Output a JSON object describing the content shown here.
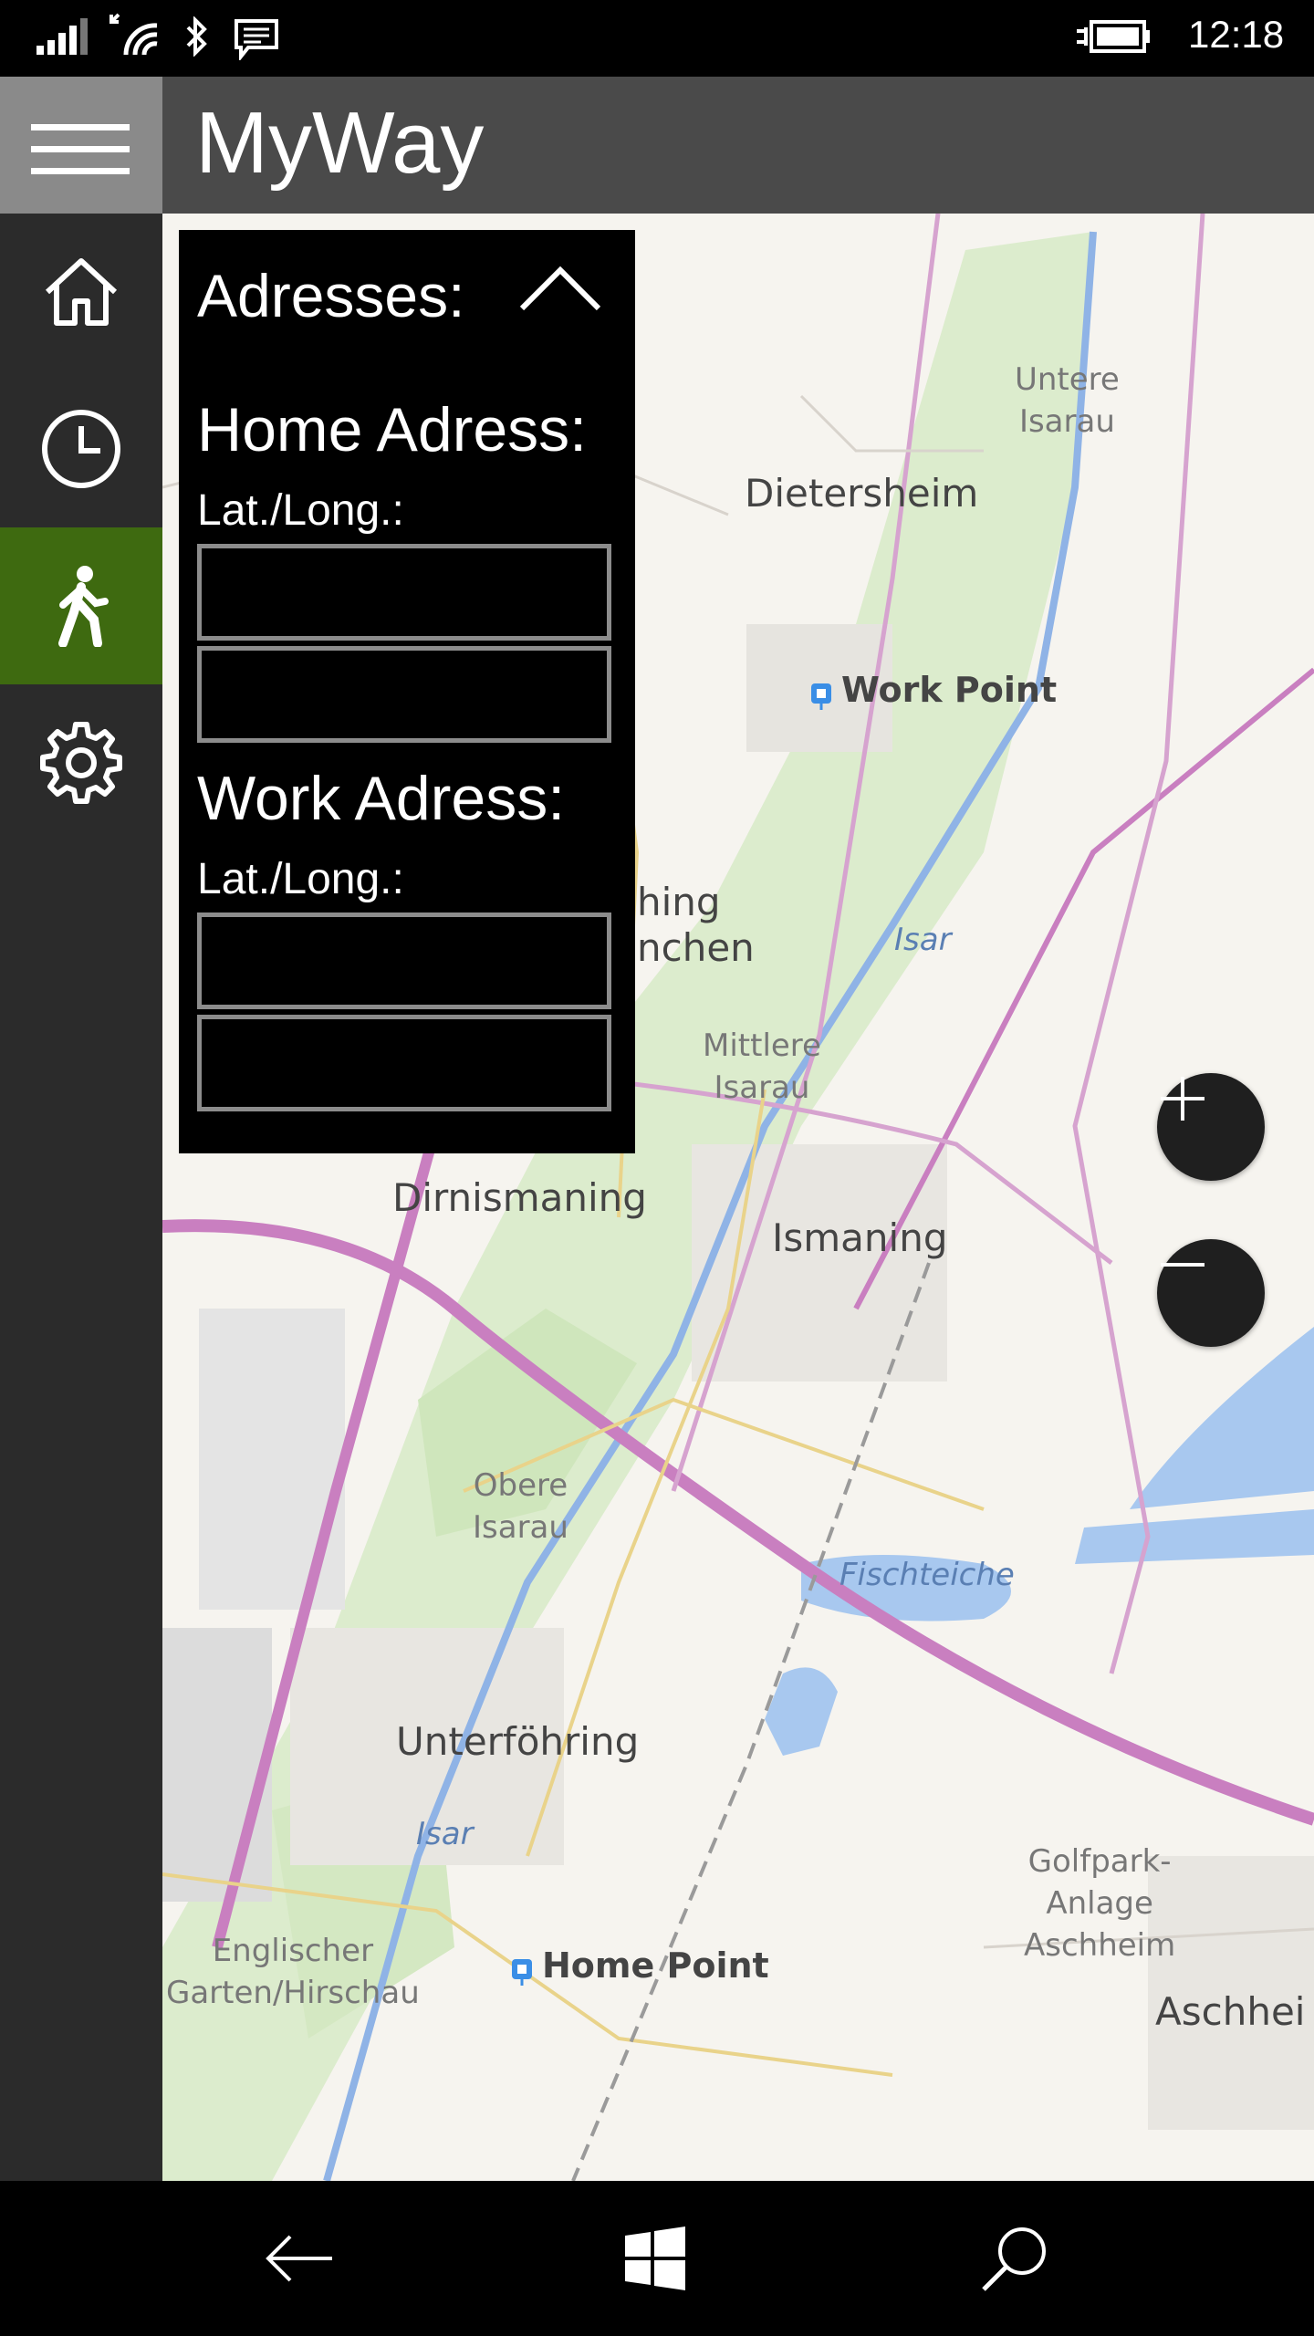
{
  "status": {
    "time": "12:18"
  },
  "app": {
    "title": "MyWay"
  },
  "nav": {
    "items": [
      {
        "icon": "home-icon"
      },
      {
        "icon": "clock-icon"
      },
      {
        "icon": "walk-icon",
        "active": true
      },
      {
        "icon": "gear-icon"
      }
    ],
    "active_color": "#3e6a10"
  },
  "panel": {
    "title": "Adresses:",
    "home": {
      "title": "Home Adress:",
      "coord_label": "Lat./Long.:",
      "lat": "",
      "long": ""
    },
    "work": {
      "title": "Work Adress:",
      "coord_label": "Lat./Long.:",
      "lat": "",
      "long": ""
    }
  },
  "map": {
    "towns": [
      "Dietersheim",
      "Dirnismaning",
      "Ismaning",
      "Unterföhring",
      "Aschhei"
    ],
    "partial_labels": [
      "hing",
      "nchen"
    ],
    "small_labels": [
      "Untere\nIsarau",
      "Mittlere\nIsarau",
      "Obere\nIsarau",
      "Golfpark-\nAnlage\nAschheim",
      "Englischer\nGarten/Hirschau"
    ],
    "water_labels": [
      "Isar",
      "Fischteiche",
      "Isar"
    ],
    "points": [
      "Work Point",
      "Home Point"
    ]
  }
}
